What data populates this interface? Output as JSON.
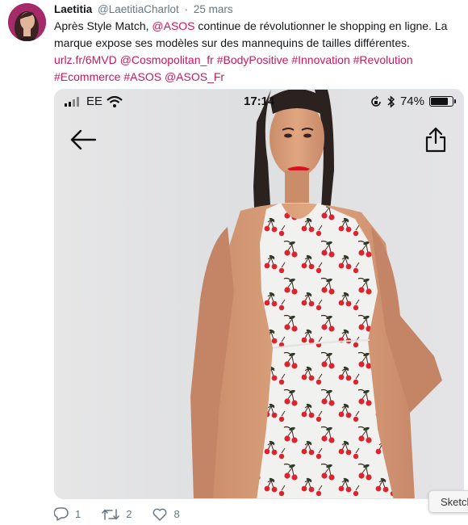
{
  "tweet": {
    "name": "Laetitia",
    "handle": "@LaetitiaCharlot",
    "separator": "·",
    "date": "25 mars",
    "text_intro": "Après Style Match, ",
    "mention_asos": "@ASOS",
    "text_body": " continue de révolutionner le shopping en ligne. La marque expose ses modèles sur des mannequins de tailles différentes.",
    "tags_line1": [
      "urlz.fr/6MVD",
      "@Cosmopolitan_fr",
      "#BodyPositive",
      "#Innovation",
      "#Revolution"
    ],
    "tags_line2": [
      "#Ecommerce",
      "#ASOS",
      "@ASOS_Fr"
    ]
  },
  "phone_status": {
    "carrier": "EE",
    "time": "17:14",
    "battery_text": "74%",
    "battery_level": 0.74
  },
  "actions": {
    "replies": "1",
    "retweets": "2",
    "likes": "8"
  },
  "tooltip": {
    "label": "Sketch"
  },
  "colors": {
    "link": "#c8175f",
    "meta": "#657786",
    "icon": "#657786"
  },
  "icons": {
    "back": "arrow-left-icon",
    "share": "share-icon",
    "reply": "reply-icon",
    "retweet": "retweet-icon",
    "like": "heart-icon",
    "wifi": "wifi-icon",
    "signal": "signal-bars-icon",
    "bluetooth": "bluetooth-icon",
    "lock": "rotation-lock-icon",
    "battery": "battery-icon"
  }
}
